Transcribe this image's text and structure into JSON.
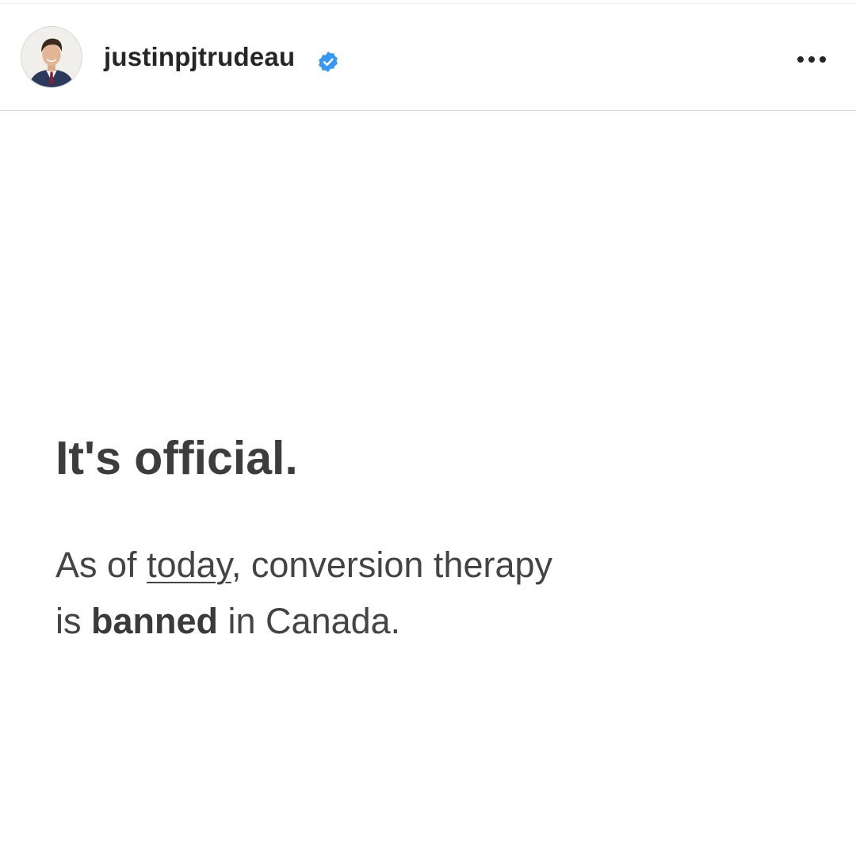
{
  "header": {
    "username": "justinpjtrudeau",
    "verified_icon": "verified-badge-icon",
    "more_icon": "more-options-icon",
    "verified_color": "#3897f0"
  },
  "post": {
    "headline": "It's official.",
    "line1_prefix": "As of ",
    "line1_underlined": "today",
    "line1_suffix": ", conversion therapy",
    "line2_prefix": "is ",
    "line2_bold": "banned",
    "line2_suffix": " in Canada."
  },
  "colors": {
    "text_dark": "#3d3d3d",
    "divider": "#dbdbdb"
  }
}
